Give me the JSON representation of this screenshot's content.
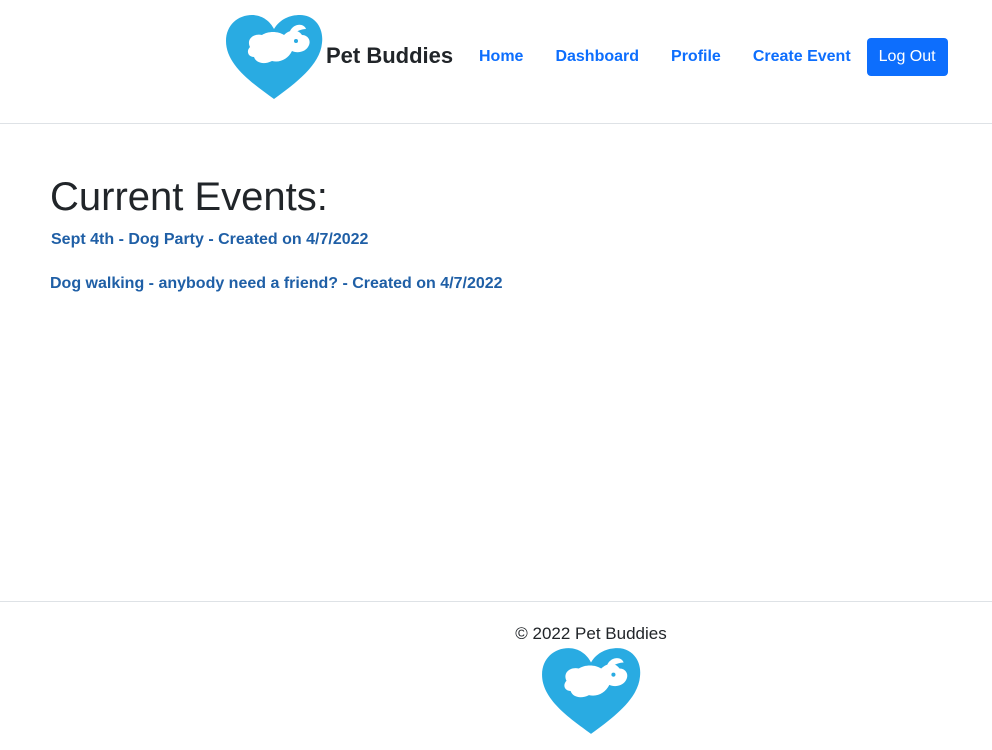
{
  "brand": {
    "name": "Pet Buddies",
    "logo_icon": "heart-dog-logo-icon",
    "logo_color": "#29abe2"
  },
  "nav": {
    "home": "Home",
    "dashboard": "Dashboard",
    "profile": "Profile",
    "create_event": "Create Event",
    "logout": "Log Out",
    "link_color": "#0d6efd",
    "button_color": "#0d6efd"
  },
  "main": {
    "heading": "Current Events:",
    "events": [
      {
        "label": "Sept 4th - Dog Party - Created on 4/7/2022"
      },
      {
        "label": "Dog walking - anybody need a friend? - Created on 4/7/2022"
      }
    ],
    "event_color": "#1f5fa6"
  },
  "footer": {
    "copyright": "© 2022 Pet Buddies",
    "logo_icon": "heart-dog-logo-icon"
  }
}
